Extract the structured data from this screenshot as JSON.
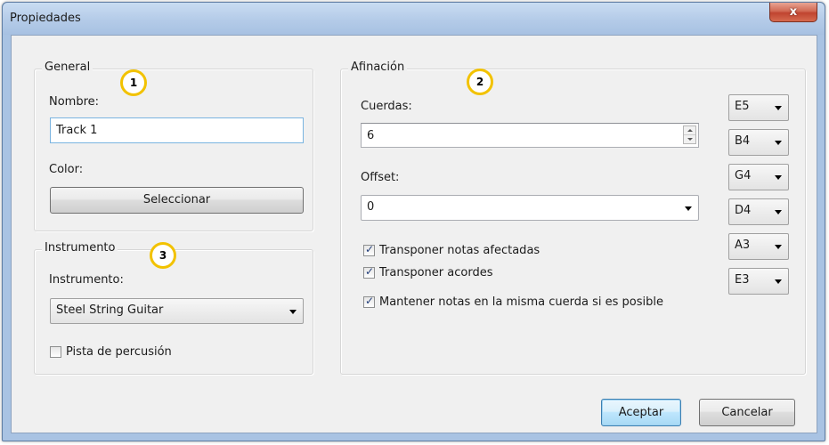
{
  "window": {
    "title": "Propiedades",
    "close_glyph": "x"
  },
  "general": {
    "legend": "General",
    "name_label": "Nombre:",
    "name_value": "Track 1",
    "color_label": "Color:",
    "select_button": "Seleccionar"
  },
  "instrument": {
    "legend": "Instrumento",
    "label": "Instrumento:",
    "value": "Steel String Guitar",
    "percussion_label": "Pista de percusión",
    "percussion_checked": false
  },
  "tuning": {
    "legend": "Afinación",
    "strings_label": "Cuerdas:",
    "strings_value": "6",
    "offset_label": "Offset:",
    "offset_value": "0",
    "checkboxes": [
      {
        "label": "Transponer notas afectadas",
        "checked": true
      },
      {
        "label": "Transponer acordes",
        "checked": true
      },
      {
        "label": "Mantener notas en la misma cuerda si es posible",
        "checked": true
      }
    ],
    "notes": [
      "E5",
      "B4",
      "G4",
      "D4",
      "A3",
      "E3"
    ]
  },
  "badges": [
    "1",
    "2",
    "3"
  ],
  "buttons": {
    "accept": "Aceptar",
    "cancel": "Cancelar"
  },
  "colors": {
    "title_bar": "#b4cbe8",
    "close_button": "#c9503a",
    "badge_ring": "#f2c200",
    "client_bg": "#f0f0f0"
  }
}
